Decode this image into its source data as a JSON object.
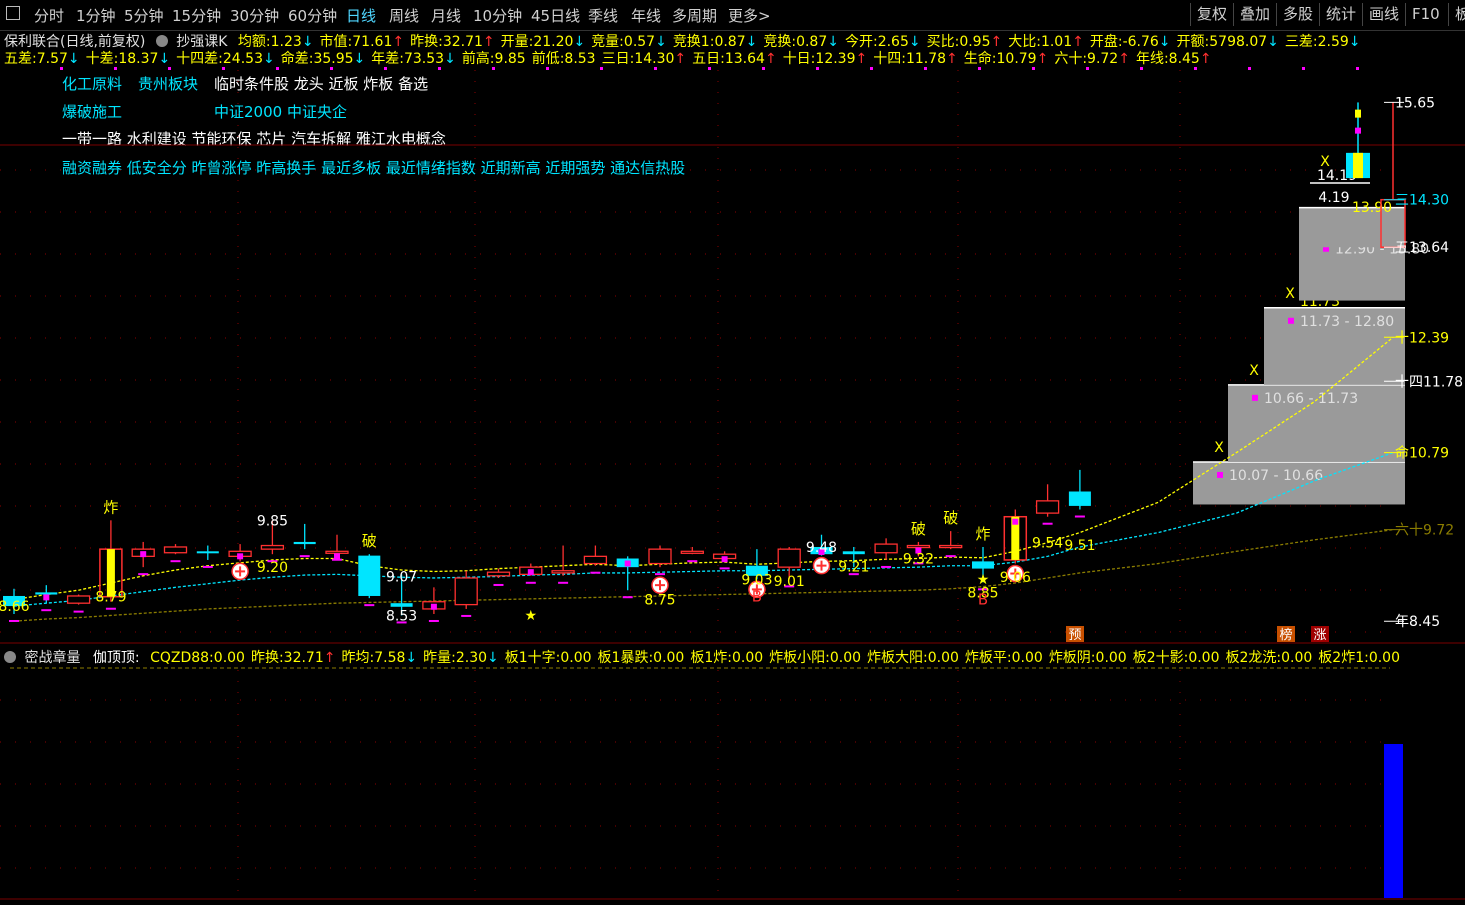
{
  "toolbar": {
    "menu_icon": "window-icon",
    "periods": [
      "分时",
      "1分钟",
      "5分钟",
      "15分钟",
      "30分钟",
      "60分钟",
      "日线",
      "周线",
      "月线",
      "10分钟",
      "45日线",
      "季线",
      "年线",
      "多周期",
      "更多>"
    ],
    "active_period": "日线",
    "right_buttons": [
      "复权",
      "叠加",
      "多股",
      "统计",
      "画线",
      "F10",
      "板"
    ]
  },
  "header": {
    "stock_title": "保利联合(日线,前复权)",
    "indicator_name": "抄强课K",
    "row1": [
      {
        "label": "均额:",
        "value": "1.23",
        "dir": "down"
      },
      {
        "label": "市值:",
        "value": "71.61",
        "dir": "up"
      },
      {
        "label": "昨换:",
        "value": "32.71",
        "dir": "up"
      },
      {
        "label": "开量:",
        "value": "21.20",
        "dir": "down"
      },
      {
        "label": "竞量:",
        "value": "0.57",
        "dir": "down"
      },
      {
        "label": "竞换1:",
        "value": "0.87",
        "dir": "down"
      },
      {
        "label": "竞换:",
        "value": "0.87",
        "dir": "down"
      },
      {
        "label": "今开:",
        "value": "2.65",
        "dir": "down"
      },
      {
        "label": "买比:",
        "value": "0.95",
        "dir": "up"
      },
      {
        "label": "大比:",
        "value": "1.01",
        "dir": "up"
      },
      {
        "label": "开盘:",
        "value": "-6.76",
        "dir": "down"
      },
      {
        "label": "开额:",
        "value": "5798.07",
        "dir": "down"
      },
      {
        "label": "三差:",
        "value": "2.59",
        "dir": "down"
      }
    ],
    "row2": [
      {
        "label": "五差:",
        "value": "7.57",
        "dir": "down"
      },
      {
        "label": "十差:",
        "value": "18.37",
        "dir": "down"
      },
      {
        "label": "十四差:",
        "value": "24.53",
        "dir": "down"
      },
      {
        "label": "命差:",
        "value": "35.95",
        "dir": "down"
      },
      {
        "label": "年差:",
        "value": "73.53",
        "dir": "down"
      },
      {
        "label": "前高:",
        "value": "9.85",
        "dir": ""
      },
      {
        "label": "前低:",
        "value": "8.53",
        "dir": ""
      },
      {
        "label": "三日:",
        "value": "14.30",
        "dir": "up"
      },
      {
        "label": "五日:",
        "value": "13.64",
        "dir": "up"
      },
      {
        "label": "十日:",
        "value": "12.39",
        "dir": "up"
      },
      {
        "label": "十四:",
        "value": "11.78",
        "dir": "up"
      },
      {
        "label": "生命:",
        "value": "10.79",
        "dir": "up"
      },
      {
        "label": "六十:",
        "value": "9.72",
        "dir": "up"
      },
      {
        "label": "年线:",
        "value": "8.45",
        "dir": "up"
      }
    ]
  },
  "sectors": {
    "line1": [
      "化工原料",
      "贵州板块",
      "临时条件股 龙头 近板 炸板 备选"
    ],
    "line2": [
      "爆破施工",
      "中证2000 中证央企"
    ],
    "line3": "一带一路 水利建设 节能环保 芯片 汽车拆解 雅江水电概念",
    "line4": "融资融券 低安全分 昨曾涨停 昨高换手 最近多板 最近情绪指数 近期新高 近期强势 通达信热股"
  },
  "sub_header": {
    "panel_name": "密战章量",
    "indicator": "伽顶顶:",
    "items": [
      {
        "label": "CQZD88:",
        "value": "0.00",
        "dir": ""
      },
      {
        "label": "昨换:",
        "value": "32.71",
        "dir": "up"
      },
      {
        "label": "昨均:",
        "value": "7.58",
        "dir": "down"
      },
      {
        "label": "昨量:",
        "value": "2.30",
        "dir": "down"
      },
      {
        "label": "板1十字:",
        "value": "0.00",
        "dir": ""
      },
      {
        "label": "板1暴跌:",
        "value": "0.00",
        "dir": ""
      },
      {
        "label": "板1炸:",
        "value": "0.00",
        "dir": ""
      },
      {
        "label": "炸板小阳:",
        "value": "0.00",
        "dir": ""
      },
      {
        "label": "炸板大阳:",
        "value": "0.00",
        "dir": ""
      },
      {
        "label": "炸板平:",
        "value": "0.00",
        "dir": ""
      },
      {
        "label": "炸板阴:",
        "value": "0.00",
        "dir": ""
      },
      {
        "label": "板2十影:",
        "value": "0.00",
        "dir": ""
      },
      {
        "label": "板2龙洗:",
        "value": "0.00",
        "dir": ""
      },
      {
        "label": "板2炸1:",
        "value": "0.00",
        "dir": ""
      }
    ]
  },
  "chart_data": {
    "type": "candlestick",
    "ylim": [
      8.3,
      16.1
    ],
    "candles": [
      {
        "o": 8.8,
        "c": 8.66,
        "h": 8.9,
        "l": 8.55
      },
      {
        "o": 8.85,
        "c": 8.82,
        "h": 8.95,
        "l": 8.7
      },
      {
        "o": 8.7,
        "c": 8.8,
        "h": 8.82,
        "l": 8.68
      },
      {
        "o": 8.79,
        "c": 9.45,
        "h": 9.85,
        "l": 8.72
      },
      {
        "o": 9.35,
        "c": 9.45,
        "h": 9.55,
        "l": 9.2
      },
      {
        "o": 9.4,
        "c": 9.48,
        "h": 9.52,
        "l": 9.38
      },
      {
        "o": 9.42,
        "c": 9.4,
        "h": 9.5,
        "l": 9.3
      },
      {
        "o": 9.35,
        "c": 9.42,
        "h": 9.52,
        "l": 9.28
      },
      {
        "o": 9.45,
        "c": 9.5,
        "h": 9.85,
        "l": 9.38
      },
      {
        "o": 9.55,
        "c": 9.52,
        "h": 9.8,
        "l": 9.45
      },
      {
        "o": 9.42,
        "c": 9.42,
        "h": 9.65,
        "l": 9.4
      },
      {
        "o": 9.36,
        "c": 8.8,
        "h": 9.38,
        "l": 8.77
      },
      {
        "o": 8.7,
        "c": 8.65,
        "h": 9.1,
        "l": 8.53
      },
      {
        "o": 8.62,
        "c": 8.72,
        "h": 8.92,
        "l": 8.55
      },
      {
        "o": 8.68,
        "c": 9.05,
        "h": 9.15,
        "l": 8.62
      },
      {
        "o": 9.08,
        "c": 9.13,
        "h": 9.18,
        "l": 9.05
      },
      {
        "o": 9.1,
        "c": 9.2,
        "h": 9.25,
        "l": 9.08
      },
      {
        "o": 9.12,
        "c": 9.15,
        "h": 9.5,
        "l": 9.08
      },
      {
        "o": 9.25,
        "c": 9.35,
        "h": 9.5,
        "l": 9.22
      },
      {
        "o": 9.32,
        "c": 9.2,
        "h": 9.35,
        "l": 8.88
      },
      {
        "o": 9.25,
        "c": 9.45,
        "h": 9.5,
        "l": 9.2
      },
      {
        "o": 9.4,
        "c": 9.42,
        "h": 9.48,
        "l": 9.38
      },
      {
        "o": 9.32,
        "c": 9.38,
        "h": 9.42,
        "l": 9.28
      },
      {
        "o": 9.22,
        "c": 9.08,
        "h": 9.45,
        "l": 9.03
      },
      {
        "o": 9.2,
        "c": 9.45,
        "h": 9.48,
        "l": 9.03
      },
      {
        "o": 9.48,
        "c": 9.38,
        "h": 9.65,
        "l": 9.36
      },
      {
        "o": 9.42,
        "c": 9.38,
        "h": 9.48,
        "l": 9.2
      },
      {
        "o": 9.4,
        "c": 9.52,
        "h": 9.6,
        "l": 9.3
      },
      {
        "o": 9.48,
        "c": 9.5,
        "h": 9.55,
        "l": 9.35
      },
      {
        "o": 9.5,
        "c": 9.5,
        "h": 9.7,
        "l": 9.45
      },
      {
        "o": 9.28,
        "c": 9.18,
        "h": 9.48,
        "l": 8.99
      },
      {
        "o": 9.3,
        "c": 9.9,
        "h": 10.0,
        "l": 9.25
      },
      {
        "o": 9.95,
        "c": 10.12,
        "h": 10.35,
        "l": 9.9
      },
      {
        "o": 10.25,
        "c": 10.05,
        "h": 10.55,
        "l": 10.0
      }
    ],
    "limit_candles": [
      3,
      31
    ],
    "ma_yellow": [
      8.75,
      8.82,
      8.88,
      8.98,
      9.08,
      9.16,
      9.22,
      9.26,
      9.3,
      9.32,
      9.32,
      9.22,
      9.16,
      9.14,
      9.15,
      9.18,
      9.2,
      9.22,
      9.24,
      9.22,
      9.24,
      9.26,
      9.27,
      9.24,
      9.26,
      9.28,
      9.29,
      9.31,
      9.32,
      9.34,
      9.33,
      9.42,
      9.54,
      9.68,
      10.1,
      10.79,
      11.5,
      12.39
    ],
    "ma_cyan": [
      8.66,
      8.7,
      8.74,
      8.8,
      8.86,
      8.92,
      8.97,
      9.02,
      9.06,
      9.09,
      9.1,
      9.08,
      9.06,
      9.05,
      9.06,
      9.07,
      9.09,
      9.1,
      9.12,
      9.12,
      9.13,
      9.14,
      9.15,
      9.15,
      9.16,
      9.17,
      9.18,
      9.19,
      9.2,
      9.22,
      9.22,
      9.27,
      9.35,
      9.48,
      9.68,
      9.95,
      10.4,
      10.79
    ],
    "ma_olive": [
      8.45,
      8.48,
      8.5,
      8.53,
      8.56,
      8.59,
      8.62,
      8.64,
      8.66,
      8.68,
      8.7,
      8.71,
      8.72,
      8.73,
      8.74,
      8.75,
      8.76,
      8.77,
      8.78,
      8.79,
      8.8,
      8.81,
      8.82,
      8.83,
      8.84,
      8.85,
      8.86,
      8.87,
      8.88,
      8.9,
      8.93,
      8.98,
      9.05,
      9.12,
      9.25,
      9.42,
      9.58,
      9.72
    ],
    "price_labels": [
      {
        "i": 0,
        "v": 8.66,
        "text": "8.66",
        "color": "#ffff00"
      },
      {
        "i": 3,
        "v": 8.79,
        "text": "8.79",
        "color": "#ffff00"
      },
      {
        "i": 8,
        "v": 9.85,
        "text": "9.85",
        "color": "#ffffff"
      },
      {
        "i": 8,
        "v": 9.2,
        "text": "9.20",
        "color": "#ffff00"
      },
      {
        "i": 12,
        "v": 9.07,
        "text": "9.07",
        "color": "#ffffff"
      },
      {
        "i": 12,
        "v": 8.53,
        "text": "8.53",
        "color": "#ffffff"
      },
      {
        "i": 20,
        "v": 8.75,
        "text": "8.75",
        "color": "#ffff00"
      },
      {
        "i": 23,
        "v": 9.03,
        "text": "9.03",
        "color": "#ffff00"
      },
      {
        "i": 24,
        "v": 9.01,
        "text": "9.01",
        "color": "#ffff00"
      },
      {
        "i": 25,
        "v": 9.48,
        "text": "9.48",
        "color": "#ffffff"
      },
      {
        "i": 26,
        "v": 9.21,
        "text": "9.21",
        "color": "#ffff00"
      },
      {
        "i": 28,
        "v": 9.32,
        "text": "9.32",
        "color": "#ffff00"
      },
      {
        "i": 30,
        "v": 8.85,
        "text": "8.85",
        "color": "#ffff00"
      },
      {
        "i": 31,
        "v": 9.06,
        "text": "9.06",
        "color": "#ffff00"
      },
      {
        "i": 32,
        "v": 9.54,
        "text": "9.54",
        "color": "#ffff00"
      },
      {
        "i": 33,
        "v": 9.51,
        "text": "9.51",
        "color": "#ffff00"
      }
    ],
    "zones": [
      {
        "lo": 10.07,
        "hi": 10.66,
        "label": "10.07 - 10.66",
        "top_label": "10.66",
        "color": "#ffffff"
      },
      {
        "lo": 10.66,
        "hi": 11.73,
        "label": "10.66 - 11.73",
        "top_label": "10.66",
        "color": "#ffff00"
      },
      {
        "lo": 11.73,
        "hi": 12.8,
        "label": "11.73 - 12.80",
        "top_label": "11.73",
        "color": "#ffff00"
      },
      {
        "lo": 12.9,
        "hi": 13.8,
        "label": "12.90 - 13.80",
        "top_label": "12.90",
        "color": "#ffff00"
      },
      {
        "lo": 13.64,
        "hi": 14.19,
        "label": "13.64",
        "top_label": "14.19",
        "color": "#ffffff"
      }
    ],
    "right_labels": [
      {
        "v": 15.65,
        "text": "15.65",
        "color": "#ffffff"
      },
      {
        "v": 14.3,
        "text": "三14.30",
        "color": "#00e5ff"
      },
      {
        "v": 13.64,
        "text": "五13.64",
        "color": "#ffffff"
      },
      {
        "v": 12.39,
        "text": "十12.39",
        "color": "#ffff00"
      },
      {
        "v": 11.78,
        "text": "十四11.78",
        "color": "#ffffff"
      },
      {
        "v": 10.79,
        "text": "命10.79",
        "color": "#ffff00"
      },
      {
        "v": 9.72,
        "text": "六十9.72",
        "color": "#8b7d00"
      },
      {
        "v": 8.45,
        "text": "年8.45",
        "color": "#ffffff"
      }
    ],
    "misc_labels": [
      {
        "text": "14.19",
        "color": "#ffffff"
      },
      {
        "text": "13.90",
        "color": "#ffff00"
      },
      {
        "text": "4.19",
        "color": "#ffffff"
      },
      {
        "text": "X",
        "color": "#ffff00"
      }
    ],
    "signal_labels": [
      {
        "i": 3,
        "text": "炸",
        "color": "#ffff00",
        "pos": "top"
      },
      {
        "i": 11,
        "text": "破",
        "color": "#ffff00",
        "pos": "top"
      },
      {
        "i": 28,
        "text": "破",
        "color": "#ffff00",
        "pos": "top"
      },
      {
        "i": 29,
        "text": "破",
        "color": "#ffff00",
        "pos": "top"
      },
      {
        "i": 30,
        "text": "炸",
        "color": "#ffff00",
        "pos": "top"
      },
      {
        "i": 23,
        "text": "B",
        "color": "#ff3030",
        "pos": "bottom"
      },
      {
        "i": 30,
        "text": "B",
        "color": "#ff3030",
        "pos": "bottom"
      }
    ],
    "bottom_tags": [
      {
        "x": 1075,
        "text": "预",
        "bg": "#c85000"
      },
      {
        "x": 1286,
        "text": "榜",
        "bg": "#c85000"
      },
      {
        "x": 1320,
        "text": "涨",
        "bg": "#a00000"
      }
    ],
    "volume_bar": {
      "value": 1.0
    }
  },
  "colors": {
    "up": "#ff3030",
    "down": "#00e5ff",
    "ma_yellow": "#ffff00",
    "ma_cyan": "#00e5ff",
    "ma_olive": "#8b7d00",
    "zone": "#9a9a9a",
    "grid": "#8b0000",
    "magenta": "#ff00ff"
  }
}
